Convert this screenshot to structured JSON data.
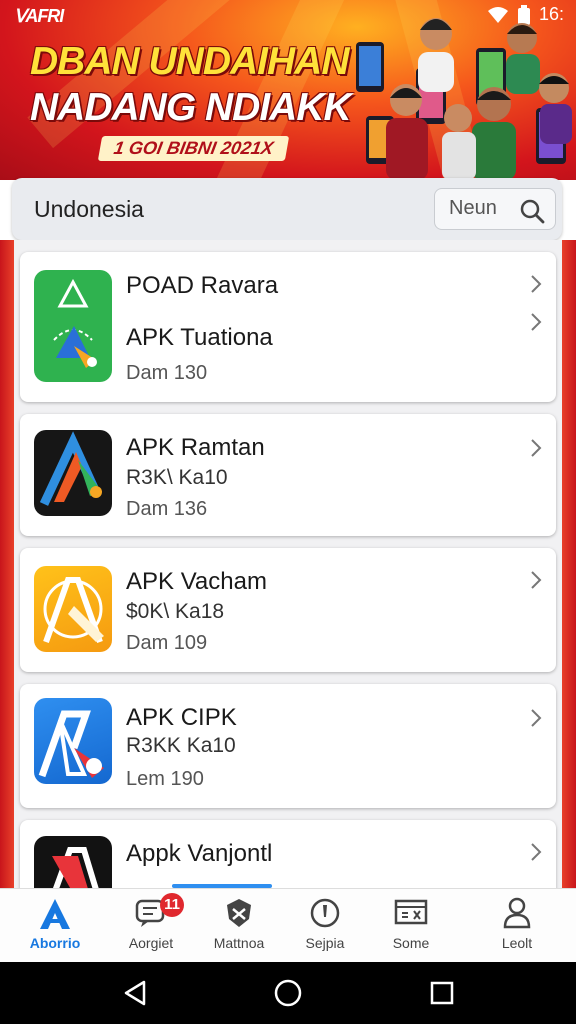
{
  "status_bar": {
    "brand": "ᐯAFRI",
    "time": "16:"
  },
  "banner": {
    "headline_line1": "DBAN UNDAIHAN",
    "headline_line2": "NADANG NDIAKK",
    "subtitle": "1 GOI BIBNI 2021X",
    "colors": {
      "yellow": "#ffe23a",
      "red": "#d3151c",
      "orange": "#f5561c"
    }
  },
  "search_bar": {
    "region_label": "Undonesia",
    "placeholder": "Neun",
    "icon": "search-icon"
  },
  "apps": [
    {
      "line1": "POAD Ravara",
      "line2": "APK Tuationa",
      "line3": "Dam 130",
      "icon": "green-triangle-app-icon"
    },
    {
      "line1": "APK Ramtan",
      "line2": "R3K\\ Ka10",
      "line3": "Dam 136",
      "icon": "dark-orange-triangle-app-icon"
    },
    {
      "line1": "APK Vacham",
      "line2": "$0K\\ Ka18",
      "line3": "Dam 109",
      "icon": "yellow-compass-app-icon"
    },
    {
      "line1": "APK CIPK",
      "line2": "R3KK Ka10",
      "line3": "Lem 190",
      "icon": "blue-triangle-app-icon"
    },
    {
      "line1": "Appk Vanjontl",
      "line2": "",
      "line3": "",
      "icon": "dark-red-triangle-app-icon"
    }
  ],
  "bottom_nav": [
    {
      "label": "Aborrio",
      "icon": "a-logo-icon",
      "active": true
    },
    {
      "label": "Aorgiet",
      "icon": "chat-bubble-icon",
      "badge": "11"
    },
    {
      "label": "Mattnoa",
      "icon": "shield-tool-icon"
    },
    {
      "label": "Sejpia",
      "icon": "tag-icon"
    },
    {
      "label": "Some",
      "icon": "cart-icon"
    },
    {
      "label": "Leolt",
      "icon": "user-icon"
    }
  ],
  "accent_color": "#1778e0"
}
